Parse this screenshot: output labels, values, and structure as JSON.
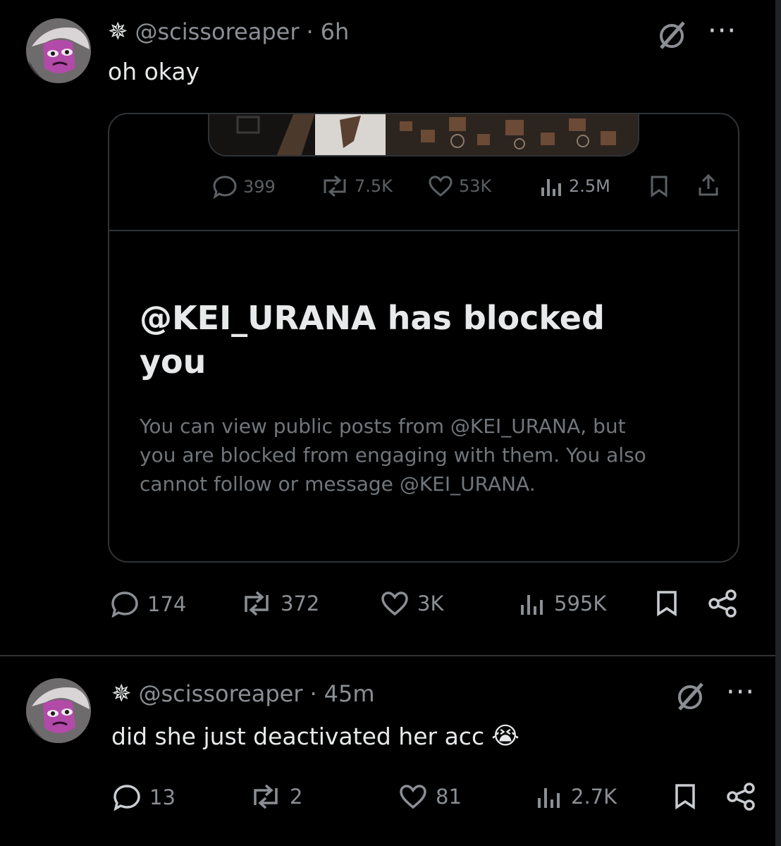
{
  "post1": {
    "username": "@scissoreaper",
    "separator": "·",
    "time": "6h",
    "text": "oh okay",
    "more_label": "···",
    "quoted": {
      "metrics": {
        "replies": "399",
        "reposts": "7.5K",
        "likes": "53K",
        "views": "2.5M"
      },
      "blocked_title_line1": "@KEI_URANA has blocked",
      "blocked_title_line2": "you",
      "blocked_body_line1": "You can view public posts from @KEI_URANA, but",
      "blocked_body_line2": "you are blocked from engaging with them. You also",
      "blocked_body_line3": "cannot follow or message @KEI_URANA."
    },
    "metrics": {
      "replies": "174",
      "reposts": "372",
      "likes": "3K",
      "views": "595K"
    }
  },
  "post2": {
    "username": "@scissoreaper",
    "separator": "·",
    "time": "45m",
    "text": "did she just deactivated her acc",
    "emoji": "😭",
    "more_label": "···",
    "metrics": {
      "replies": "13",
      "reposts": "2",
      "likes": "81",
      "views": "2.7K"
    }
  },
  "icons": {
    "star": "✵",
    "grok": "grok-icon",
    "reply": "reply-icon",
    "repost": "repost-icon",
    "like": "heart-icon",
    "views": "views-icon",
    "bookmark": "bookmark-icon",
    "share": "share-icon"
  },
  "colors": {
    "background": "#000000",
    "text": "#e7e9ea",
    "muted": "#8b8f94",
    "border": "#2f3336",
    "avatar_accent": "#c65bc0"
  }
}
